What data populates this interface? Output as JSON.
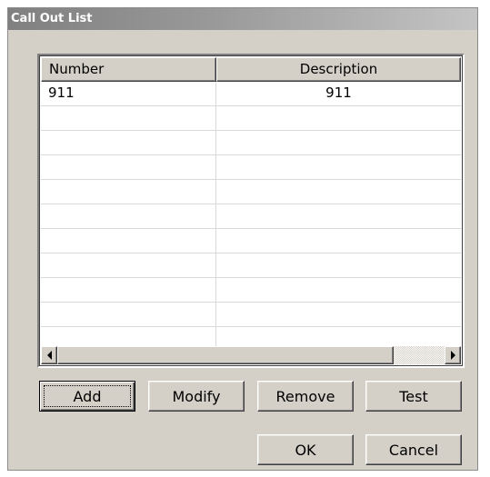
{
  "window": {
    "title": "Call Out List"
  },
  "list": {
    "columns": [
      "Number",
      "Description"
    ],
    "rows": [
      {
        "number": "911",
        "description": "911"
      }
    ]
  },
  "buttons": {
    "add": "Add",
    "modify": "Modify",
    "remove": "Remove",
    "test": "Test",
    "ok": "OK",
    "cancel": "Cancel"
  }
}
